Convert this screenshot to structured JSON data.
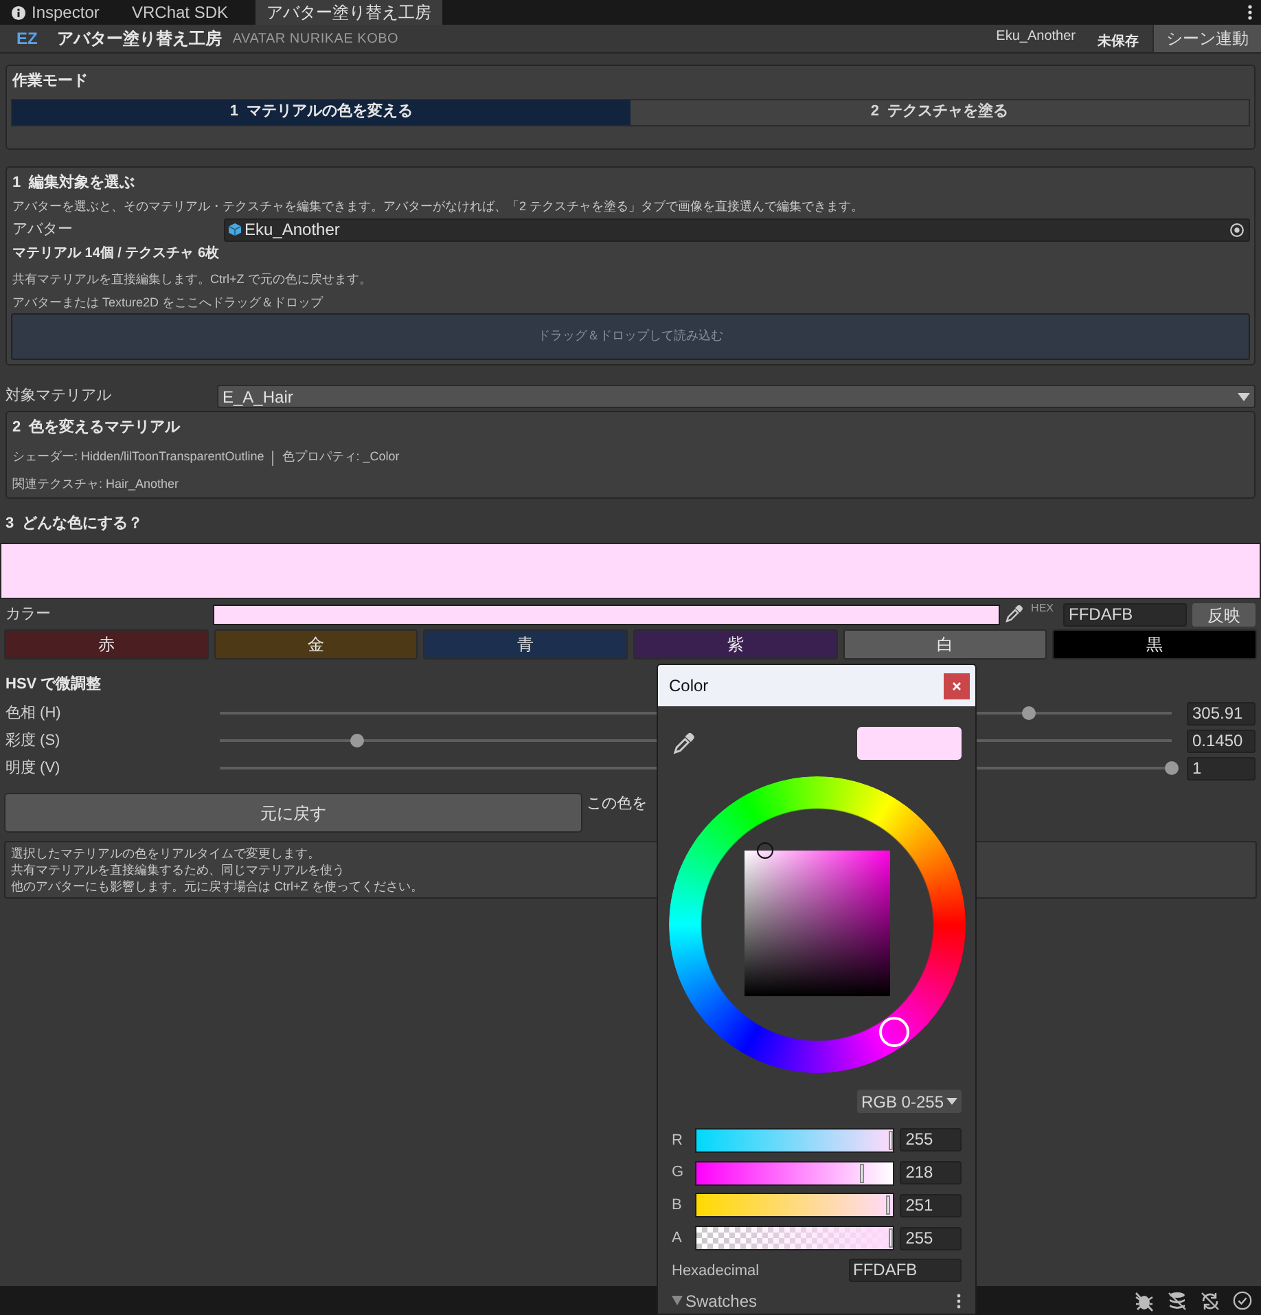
{
  "tabs": [
    {
      "label": "Inspector",
      "selected": false
    },
    {
      "label": "VRChat SDK",
      "selected": false
    },
    {
      "label": "アバター塗り替え工房",
      "selected": true
    }
  ],
  "header": {
    "logo": "EZ",
    "title": "アバター塗り替え工房",
    "subtitle": "AVATAR NURIKAE KOBO",
    "avatar_name": "Eku_Another",
    "save_status": "未保存",
    "sync_button": "シーン連動"
  },
  "work_mode": {
    "title": "作業モード",
    "modes": [
      {
        "label": "1  マテリアルの色を変える",
        "selected": true
      },
      {
        "label": "2  テクスチャを塗る",
        "selected": false
      }
    ]
  },
  "section1": {
    "title": "1  編集対象を選ぶ",
    "description": "アバターを選ぶと、そのマテリアル・テクスチャを編集できます。アバターがなければ、「2 テクスチャを塗る」タブで画像を直接選んで編集できます。",
    "avatar_label": "アバター",
    "avatar_value": "Eku_Another",
    "counts": "マテリアル 14個 / テクスチャ 6枚",
    "note": "共有マテリアルを直接編集します。Ctrl+Z で元の色に戻せます。",
    "drop_hint": "アバターまたは Texture2D をここへドラッグ＆ドロップ",
    "drop_zone": "ドラッグ＆ドロップして読み込む"
  },
  "target_material": {
    "label": "対象マテリアル",
    "value": "E_A_Hair"
  },
  "section2": {
    "title": "2  色を変えるマテリアル",
    "shader": "シェーダー: Hidden/lilToonTransparentOutline",
    "property": "色プロパティ: _Color",
    "texture": "関連テクスチャ: Hair_Another"
  },
  "section3": {
    "title": "3  どんな色にする？",
    "color_label": "カラー",
    "hex_label": "HEX",
    "hex_value": "FFDAFB",
    "apply_button": "反映"
  },
  "presets": [
    {
      "label": "赤",
      "color": "#4b1e21"
    },
    {
      "label": "金",
      "color": "#4e3916"
    },
    {
      "label": "青",
      "color": "#1c2f4e"
    },
    {
      "label": "紫",
      "color": "#3a2050"
    },
    {
      "label": "白",
      "color": "#5b5b5b"
    },
    {
      "label": "黒",
      "color": "#000000"
    }
  ],
  "hsv": {
    "title": "HSV で微調整",
    "rows": [
      {
        "label": "色相 (H)",
        "level": 0.85,
        "value": "305.91"
      },
      {
        "label": "彩度 (S)",
        "level": 0.145,
        "value": "0.1450"
      },
      {
        "label": "明度 (V)",
        "level": 1,
        "value": "1"
      }
    ]
  },
  "reset_button": "元に戻す",
  "side_text": "この色を",
  "info": [
    "選択したマテリアルの色をリアルタイムで変更します。",
    "共有マテリアルを直接編集するため、同じマテリアルを使う",
    "他のアバターにも影響します。元に戻す場合は Ctrl+Z を使ってください。"
  ],
  "color_picker": {
    "title": "Color",
    "mode": "RGB 0-255",
    "channels": [
      {
        "label": "R",
        "level": 1,
        "value": "255"
      },
      {
        "label": "G",
        "level": 0.855,
        "value": "218"
      },
      {
        "label": "B",
        "level": 0.984,
        "value": "251"
      },
      {
        "label": "A",
        "level": 1,
        "value": "255"
      }
    ],
    "hex_label": "Hexadecimal",
    "hex_value": "FFDAFB",
    "swatches": {
      "label": "Swatches",
      "expanded": true
    }
  }
}
